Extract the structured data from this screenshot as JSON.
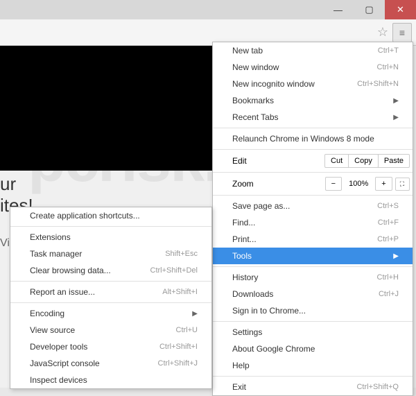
{
  "window": {
    "min": "—",
    "max": "▢",
    "close": "✕"
  },
  "page": {
    "textLine1": "ur",
    "textLine2": "ites!",
    "subtitle": "Video Dimmer"
  },
  "watermark": "pcrisk.com",
  "mainMenu": {
    "newTab": {
      "label": "New tab",
      "shortcut": "Ctrl+T"
    },
    "newWindow": {
      "label": "New window",
      "shortcut": "Ctrl+N"
    },
    "newIncognito": {
      "label": "New incognito window",
      "shortcut": "Ctrl+Shift+N"
    },
    "bookmarks": {
      "label": "Bookmarks"
    },
    "recentTabs": {
      "label": "Recent Tabs"
    },
    "relaunch": {
      "label": "Relaunch Chrome in Windows 8 mode"
    },
    "edit": {
      "label": "Edit",
      "cut": "Cut",
      "copy": "Copy",
      "paste": "Paste"
    },
    "zoom": {
      "label": "Zoom",
      "minus": "−",
      "value": "100%",
      "plus": "+",
      "full": "⛶"
    },
    "savePage": {
      "label": "Save page as...",
      "shortcut": "Ctrl+S"
    },
    "find": {
      "label": "Find...",
      "shortcut": "Ctrl+F"
    },
    "print": {
      "label": "Print...",
      "shortcut": "Ctrl+P"
    },
    "tools": {
      "label": "Tools"
    },
    "history": {
      "label": "History",
      "shortcut": "Ctrl+H"
    },
    "downloads": {
      "label": "Downloads",
      "shortcut": "Ctrl+J"
    },
    "signIn": {
      "label": "Sign in to Chrome..."
    },
    "settings": {
      "label": "Settings"
    },
    "about": {
      "label": "About Google Chrome"
    },
    "help": {
      "label": "Help"
    },
    "exit": {
      "label": "Exit",
      "shortcut": "Ctrl+Shift+Q"
    }
  },
  "submenu": {
    "createShortcuts": {
      "label": "Create application shortcuts..."
    },
    "extensions": {
      "label": "Extensions"
    },
    "taskManager": {
      "label": "Task manager",
      "shortcut": "Shift+Esc"
    },
    "clearData": {
      "label": "Clear browsing data...",
      "shortcut": "Ctrl+Shift+Del"
    },
    "reportIssue": {
      "label": "Report an issue...",
      "shortcut": "Alt+Shift+I"
    },
    "encoding": {
      "label": "Encoding"
    },
    "viewSource": {
      "label": "View source",
      "shortcut": "Ctrl+U"
    },
    "devTools": {
      "label": "Developer tools",
      "shortcut": "Ctrl+Shift+I"
    },
    "jsConsole": {
      "label": "JavaScript console",
      "shortcut": "Ctrl+Shift+J"
    },
    "inspectDevices": {
      "label": "Inspect devices"
    }
  }
}
